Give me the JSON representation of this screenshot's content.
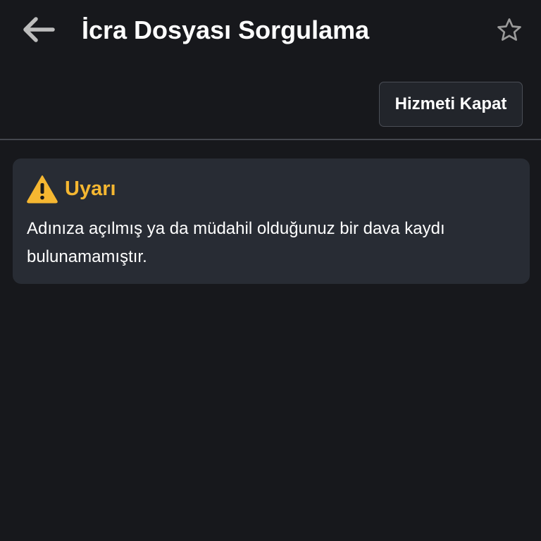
{
  "header": {
    "back_icon": "arrow-left-icon",
    "title": "İcra Dosyası Sorgulama",
    "favorite_icon": "star-outline-icon"
  },
  "toolbar": {
    "close_service_label": "Hizmeti Kapat"
  },
  "alert": {
    "icon": "warning-triangle-icon",
    "title": "Uyarı",
    "message": "Adınıza açılmış ya da müdahil olduğunuz bir dava kaydı bulunamamıştır.",
    "title_color": "#f5b731",
    "background_color": "#282c34"
  },
  "colors": {
    "background": "#17181c",
    "warning": "#f5b731",
    "divider": "#44474e"
  }
}
